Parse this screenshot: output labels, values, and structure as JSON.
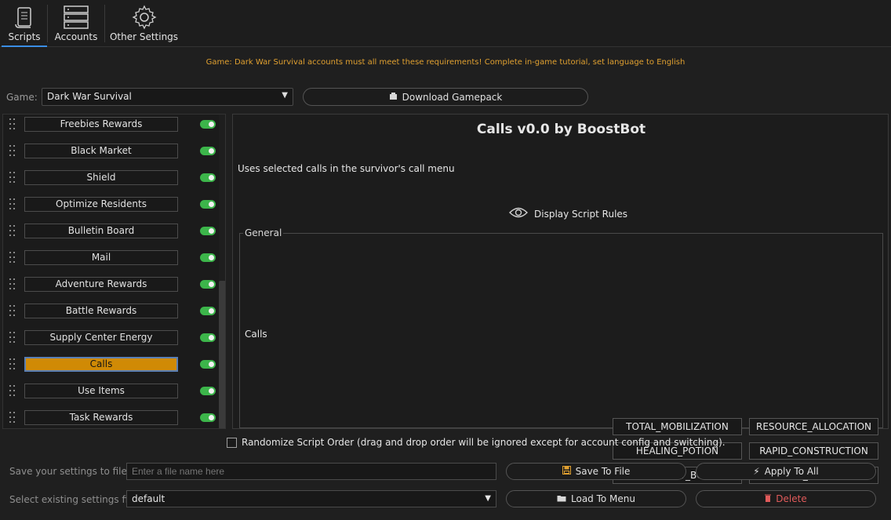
{
  "tabs": [
    {
      "label": "Scripts",
      "icon": "scroll-icon",
      "active": true
    },
    {
      "label": "Accounts",
      "icon": "server-icon",
      "active": false
    },
    {
      "label": "Other Settings",
      "icon": "gear-icon",
      "active": false
    }
  ],
  "notice": "Game: Dark War Survival accounts must all meet these requirements! Complete in-game tutorial, set language to English",
  "game": {
    "label": "Game:",
    "selected": "Dark War Survival",
    "download_label": "Download Gamepack"
  },
  "scripts": [
    {
      "label": "Freebies Rewards",
      "enabled": true,
      "selected": false
    },
    {
      "label": "Black Market",
      "enabled": true,
      "selected": false
    },
    {
      "label": "Shield",
      "enabled": true,
      "selected": false
    },
    {
      "label": "Optimize Residents",
      "enabled": true,
      "selected": false
    },
    {
      "label": "Bulletin Board",
      "enabled": true,
      "selected": false
    },
    {
      "label": "Mail",
      "enabled": true,
      "selected": false
    },
    {
      "label": "Adventure Rewards",
      "enabled": true,
      "selected": false
    },
    {
      "label": "Battle Rewards",
      "enabled": true,
      "selected": false
    },
    {
      "label": "Supply Center Energy",
      "enabled": true,
      "selected": false
    },
    {
      "label": "Calls",
      "enabled": true,
      "selected": true
    },
    {
      "label": "Use Items",
      "enabled": true,
      "selected": false
    },
    {
      "label": "Task Rewards",
      "enabled": true,
      "selected": false
    }
  ],
  "detail": {
    "title": "Calls v0.0 by BoostBot",
    "description": "Uses selected calls in the survivor's call menu",
    "rules_label": "Display Script Rules",
    "group_title": "General",
    "calls_label": "Calls",
    "call_options": [
      "TOTAL_MOBILIZATION",
      "RESOURCE_ALLOCATION",
      "HEALING_POTION",
      "RAPID_CONSTRUCTION",
      "EFFICIENCY_BOOST",
      "SURVIVOR_CELEBRATION"
    ]
  },
  "randomize_label": "Randomize Script Order (drag and drop order will be ignored except for account config and switching).",
  "footer": {
    "save_label": "Save your settings to file",
    "save_placeholder": "Enter a file name here",
    "save_button": "Save To File",
    "apply_button": "Apply To All",
    "select_label": "Select existing settings file",
    "select_value": "default",
    "load_button": "Load To Menu",
    "delete_button": "Delete"
  },
  "colors": {
    "accent_selected": "#d08a05",
    "toggle_on": "#3cb54a",
    "notice": "#e0a030",
    "delete": "#e05a5a"
  }
}
